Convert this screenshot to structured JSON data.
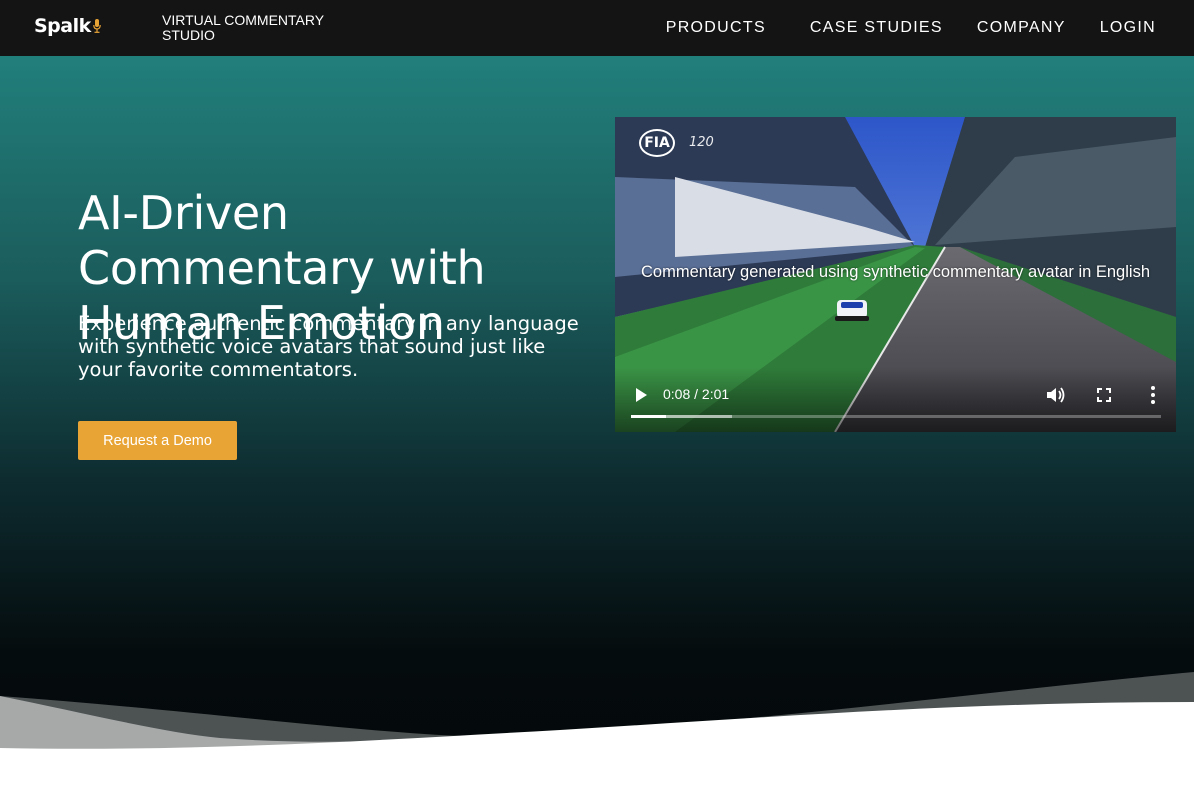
{
  "nav": {
    "logo_text": "Spalk",
    "product_name": "VIRTUAL COMMENTARY STUDIO",
    "items": [
      "PRODUCTS",
      "CASE STUDIES",
      "COMPANY",
      "LOGIN"
    ]
  },
  "hero": {
    "title": "AI-Driven Commentary with Human Emotion",
    "subtitle": "Experience authentic commentary in any language with synthetic voice avatars that sound just like your favorite commentators.",
    "cta_label": "Request a Demo"
  },
  "video": {
    "overlay_logo": "FIA",
    "overlay_badge": "120",
    "caption": "Commentary generated using synthetic commentary avatar in English",
    "time_display": "0:08 / 2:01",
    "progress_played": 0.066,
    "progress_buffered": 0.19,
    "icons": [
      "play-icon",
      "volume-icon",
      "fullscreen-icon",
      "more-options-icon"
    ]
  },
  "colors": {
    "nav_bg": "#141414",
    "hero_top": "#217f7b",
    "hero_bottom": "#040808",
    "cta": "#e9a436"
  }
}
